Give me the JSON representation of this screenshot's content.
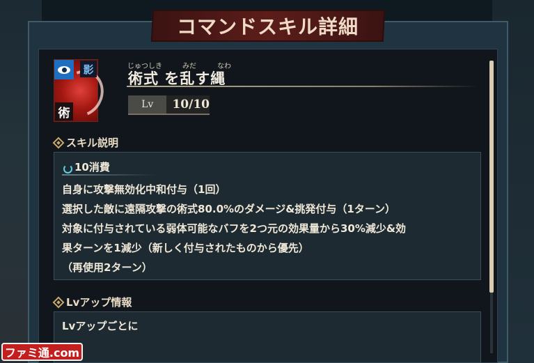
{
  "dialog": {
    "title": "コマンドスキル詳細"
  },
  "skill": {
    "name": "術式 を乱す縄",
    "ruby": [
      "じゅつしき",
      "みだ",
      "なわ"
    ],
    "icon": {
      "name": "skill-icon",
      "tags": {
        "shadow": "影",
        "jutsu": "術"
      }
    },
    "level": {
      "label": "Lv",
      "value": "10/10"
    }
  },
  "description": {
    "header": "スキル説明",
    "cost": "10消費",
    "lines": [
      "自身に攻撃無効化中和付与（1回）",
      "選択した敵に遠隔攻撃の術式80.0%のダメージ&挑発付与（1ターン）",
      "対象に付与されている弱体可能なバフを2つ元の効果量から30%減少&効",
      "果ターンを1減少（新しく付与されたものから優先）",
      "（再使用2ターン）"
    ]
  },
  "lvup": {
    "header": "Lvアップ情報",
    "text": "Lvアップごとに"
  },
  "watermark": "ファミ通.com",
  "colors": {
    "accent": "#c9a96b",
    "banner": "#5c1d1a",
    "panel": "#1e2a31"
  }
}
